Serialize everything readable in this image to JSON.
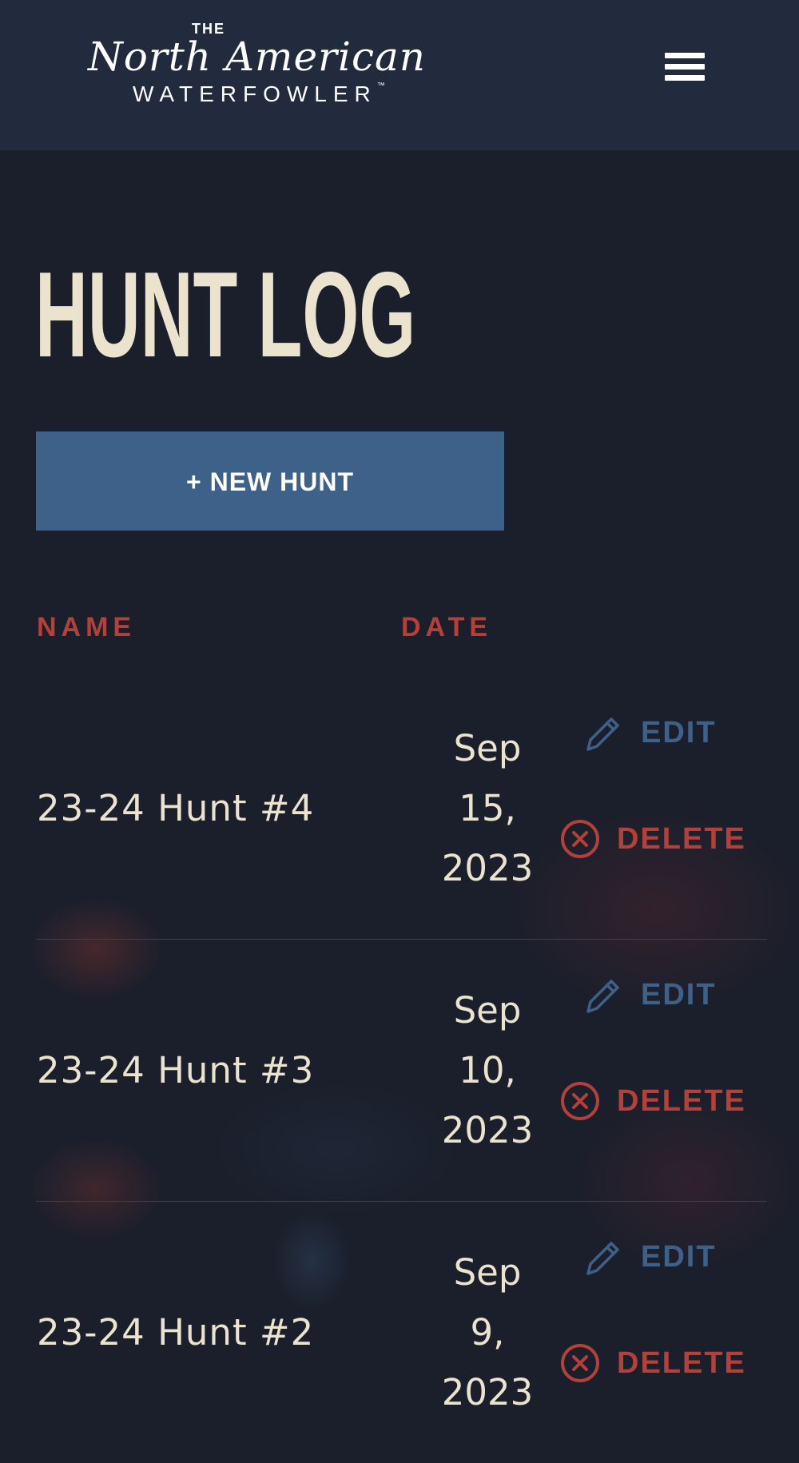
{
  "header": {
    "logo": {
      "the": "THE",
      "main": "North American",
      "sub": "WATERFOWLER",
      "tm": "™"
    },
    "menu_icon": "hamburger-menu-icon"
  },
  "page": {
    "title": "HUNT LOG",
    "new_hunt_label": "+ NEW HUNT"
  },
  "table": {
    "headers": {
      "name": "NAME",
      "date": "DATE"
    },
    "edit_label": "EDIT",
    "delete_label": "DELETE",
    "rows": [
      {
        "name": "23-24 Hunt #4",
        "date_month": "Sep",
        "date_day": "15,",
        "date_year": "2023"
      },
      {
        "name": "23-24 Hunt #3",
        "date_month": "Sep",
        "date_day": "10,",
        "date_year": "2023"
      },
      {
        "name": "23-24 Hunt #2",
        "date_month": "Sep",
        "date_day": "9,",
        "date_year": "2023"
      }
    ]
  },
  "colors": {
    "header_bg": "#222a3d",
    "page_bg": "#1b1f2b",
    "accent_blue": "#3e6189",
    "accent_red": "#b4403a",
    "cream_text": "#ece3cf"
  }
}
